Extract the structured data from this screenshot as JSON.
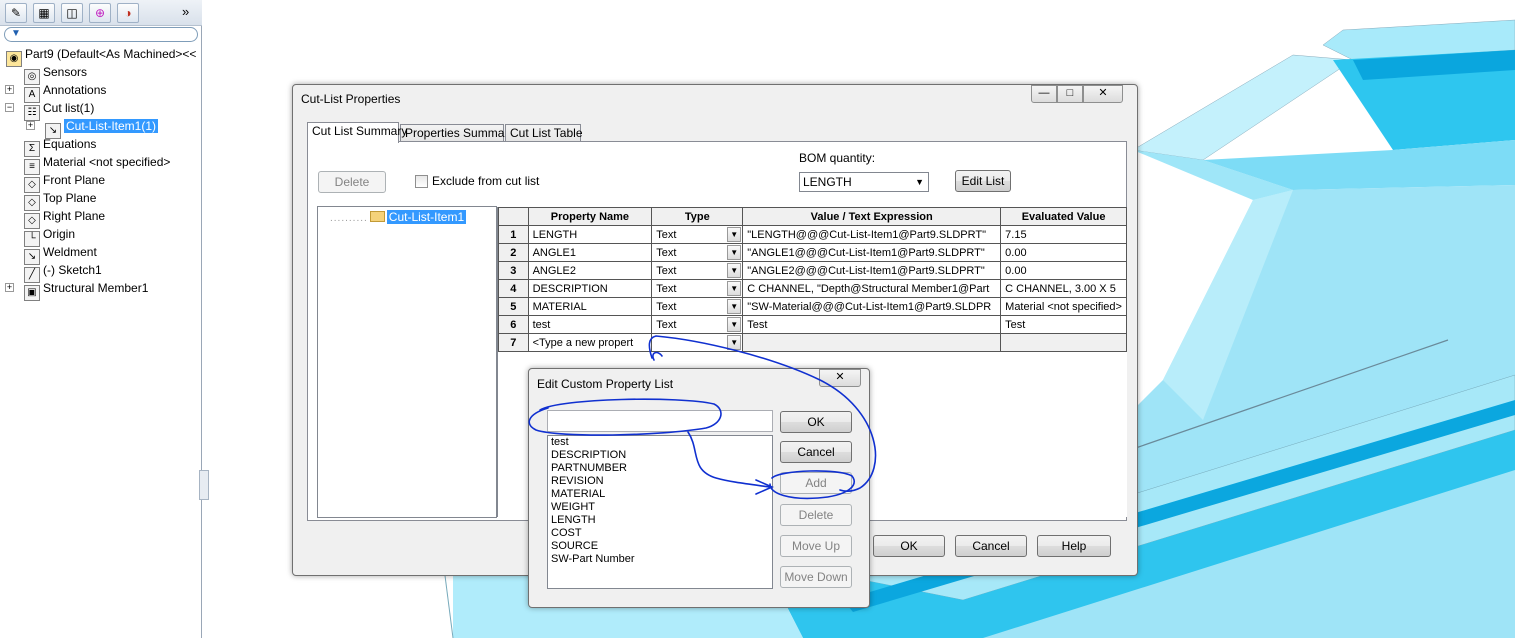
{
  "tree": {
    "root_label": "Part9  (Default<As Machined><<",
    "items": [
      {
        "label": "Sensors",
        "icon": "sensor-icon",
        "glyph": "◎",
        "expand": ""
      },
      {
        "label": "Annotations",
        "icon": "annotations-icon",
        "glyph": "A",
        "expand": "+"
      },
      {
        "label": "Cut list(1)",
        "icon": "cut-list-icon",
        "glyph": "☷",
        "expand": "−"
      },
      {
        "label": "Cut-List-Item1(1)",
        "icon": "cut-list-item-icon",
        "glyph": "↘",
        "expand": "+",
        "selected": true
      },
      {
        "label": "Equations",
        "icon": "equations-icon",
        "glyph": "Σ",
        "expand": ""
      },
      {
        "label": "Material <not specified>",
        "icon": "material-icon",
        "glyph": "≡",
        "expand": ""
      },
      {
        "label": "Front Plane",
        "icon": "plane-icon",
        "glyph": "◇",
        "expand": ""
      },
      {
        "label": "Top Plane",
        "icon": "plane-icon",
        "glyph": "◇",
        "expand": ""
      },
      {
        "label": "Right Plane",
        "icon": "plane-icon",
        "glyph": "◇",
        "expand": ""
      },
      {
        "label": "Origin",
        "icon": "origin-icon",
        "glyph": "└",
        "expand": ""
      },
      {
        "label": "Weldment",
        "icon": "weldment-icon",
        "glyph": "↘",
        "expand": ""
      },
      {
        "label": "(-) Sketch1",
        "icon": "sketch-icon",
        "glyph": "╱",
        "expand": ""
      },
      {
        "label": "Structural Member1",
        "icon": "structural-member-icon",
        "glyph": "▣",
        "expand": "+"
      }
    ],
    "collapse_glyph": "»"
  },
  "cut_dialog": {
    "title": "Cut-List Properties",
    "tabs": [
      "Cut List Summary",
      "Properties Summary",
      "Cut List Table"
    ],
    "delete_label": "Delete",
    "exclude_label": "Exclude from cut list",
    "bom_label": "BOM quantity:",
    "bom_value": "LENGTH",
    "edit_list_label": "Edit List",
    "tree_item": "Cut-List-Item1",
    "columns": [
      "Property Name",
      "Type",
      "Value / Text Expression",
      "Evaluated Value"
    ],
    "rows": [
      {
        "n": "1",
        "name": "LENGTH",
        "type": "Text",
        "value": "\"LENGTH@@@Cut-List-Item1@Part9.SLDPRT\"",
        "eval": "7.15"
      },
      {
        "n": "2",
        "name": "ANGLE1",
        "type": "Text",
        "value": "\"ANGLE1@@@Cut-List-Item1@Part9.SLDPRT\"",
        "eval": "0.00"
      },
      {
        "n": "3",
        "name": "ANGLE2",
        "type": "Text",
        "value": "\"ANGLE2@@@Cut-List-Item1@Part9.SLDPRT\"",
        "eval": "0.00"
      },
      {
        "n": "4",
        "name": "DESCRIPTION",
        "type": "Text",
        "value": " C CHANNEL, \"Depth@Structural Member1@Part",
        "eval": " C CHANNEL, 3.00 X 5"
      },
      {
        "n": "5",
        "name": "MATERIAL",
        "type": "Text",
        "value": "\"SW-Material@@@Cut-List-Item1@Part9.SLDPR",
        "eval": "Material <not specified>"
      },
      {
        "n": "6",
        "name": "test",
        "type": "Text",
        "value": "Test",
        "eval": "Test"
      },
      {
        "n": "7",
        "name": "<Type a new propert",
        "type": "",
        "value": "",
        "eval": ""
      }
    ],
    "ok_label": "OK",
    "cancel_label": "Cancel",
    "help_label": "Help"
  },
  "edit_dialog": {
    "title": "Edit Custom Property List",
    "input_value": "",
    "list": [
      "test",
      "DESCRIPTION",
      "PARTNUMBER",
      "REVISION",
      "MATERIAL",
      "WEIGHT",
      "LENGTH",
      "COST",
      "SOURCE",
      "SW-Part Number"
    ],
    "ok_label": "OK",
    "cancel_label": "Cancel",
    "add_label": "Add",
    "delete_label": "Delete",
    "move_up_label": "Move Up",
    "move_down_label": "Move Down",
    "close_glyph": "✕"
  },
  "colors": {
    "accent": "#3399ff",
    "model_blue": "#5ad4f4",
    "ink": "#1030d0"
  }
}
